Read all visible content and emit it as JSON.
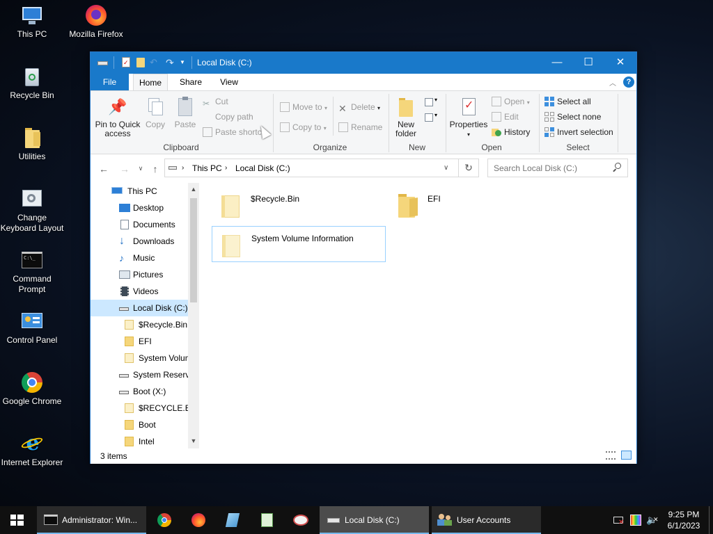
{
  "desktop": {
    "icons": [
      {
        "label": "This PC",
        "icon": "this-pc-icon"
      },
      {
        "label": "Mozilla Firefox",
        "icon": "firefox-icon"
      },
      {
        "label": "Recycle Bin",
        "icon": "recycle-bin-icon"
      },
      {
        "label": "Utilities",
        "icon": "folder-icon"
      },
      {
        "label": "Change Keyboard Layout",
        "icon": "keyboard-layout-icon"
      },
      {
        "label": "Command Prompt",
        "icon": "command-prompt-icon"
      },
      {
        "label": "Control Panel",
        "icon": "control-panel-icon"
      },
      {
        "label": "Google Chrome",
        "icon": "chrome-icon"
      },
      {
        "label": "Internet Explorer",
        "icon": "internet-explorer-icon"
      }
    ]
  },
  "window": {
    "title": "Local Disk (C:)",
    "controls": {
      "minimize": "—",
      "maximize": "☐",
      "close": "✕"
    },
    "accent": "#1979ca"
  },
  "menu_tabs": {
    "file": "File",
    "home": "Home",
    "share": "Share",
    "view": "View"
  },
  "ribbon": {
    "clipboard": {
      "pin": "Pin to Quick access",
      "copy": "Copy",
      "paste": "Paste",
      "cut": "Cut",
      "copy_path": "Copy path",
      "paste_shortcut": "Paste shortcut",
      "group": "Clipboard"
    },
    "organize": {
      "move_to": "Move to",
      "copy_to": "Copy to",
      "delete": "Delete",
      "rename": "Rename",
      "group": "Organize"
    },
    "new": {
      "new_folder": "New folder",
      "group": "New"
    },
    "open": {
      "properties": "Properties",
      "open": "Open",
      "edit": "Edit",
      "history": "History",
      "group": "Open"
    },
    "select": {
      "select_all": "Select all",
      "select_none": "Select none",
      "invert_selection": "Invert selection",
      "group": "Select"
    }
  },
  "address": {
    "breadcrumb": [
      "This PC",
      "Local Disk (C:)"
    ],
    "search_placeholder": "Search Local Disk (C:)"
  },
  "nav": {
    "items": [
      {
        "label": "This PC",
        "icon": "this-pc-icon"
      },
      {
        "label": "Desktop",
        "icon": "desktop-icon"
      },
      {
        "label": "Documents",
        "icon": "documents-icon"
      },
      {
        "label": "Downloads",
        "icon": "downloads-icon"
      },
      {
        "label": "Music",
        "icon": "music-icon"
      },
      {
        "label": "Pictures",
        "icon": "pictures-icon"
      },
      {
        "label": "Videos",
        "icon": "videos-icon"
      },
      {
        "label": "Local Disk (C:)",
        "icon": "drive-icon",
        "selected": true
      },
      {
        "label": "$Recycle.Bin",
        "icon": "folder-icon"
      },
      {
        "label": "EFI",
        "icon": "folder-icon"
      },
      {
        "label": "System Volume Information",
        "icon": "folder-icon"
      },
      {
        "label": "System Reserved",
        "icon": "drive-icon"
      },
      {
        "label": "Boot (X:)",
        "icon": "drive-icon"
      },
      {
        "label": "$RECYCLE.BIN",
        "icon": "folder-icon"
      },
      {
        "label": "Boot",
        "icon": "folder-icon"
      },
      {
        "label": "Intel",
        "icon": "folder-icon"
      }
    ]
  },
  "content": {
    "items": [
      {
        "name": "$Recycle.Bin"
      },
      {
        "name": "EFI"
      },
      {
        "name": "System Volume Information",
        "selected": true
      }
    ]
  },
  "status": {
    "item_count": "3 items"
  },
  "taskbar": {
    "start": "start-icon",
    "buttons": [
      {
        "label": "Administrator: Win...",
        "icon": "command-prompt-icon"
      },
      {
        "label": "Local Disk (C:)",
        "icon": "drive-icon",
        "active": true
      },
      {
        "label": "User Accounts",
        "icon": "user-accounts-icon"
      }
    ],
    "pinned": [
      "chrome-icon",
      "firefox-icon",
      "app-icon",
      "notepad-icon",
      "paint-icon"
    ],
    "tray": [
      "network-icon",
      "color-icon",
      "volume-muted-icon"
    ],
    "clock": {
      "time": "9:25 PM",
      "date": "6/1/2023"
    }
  }
}
